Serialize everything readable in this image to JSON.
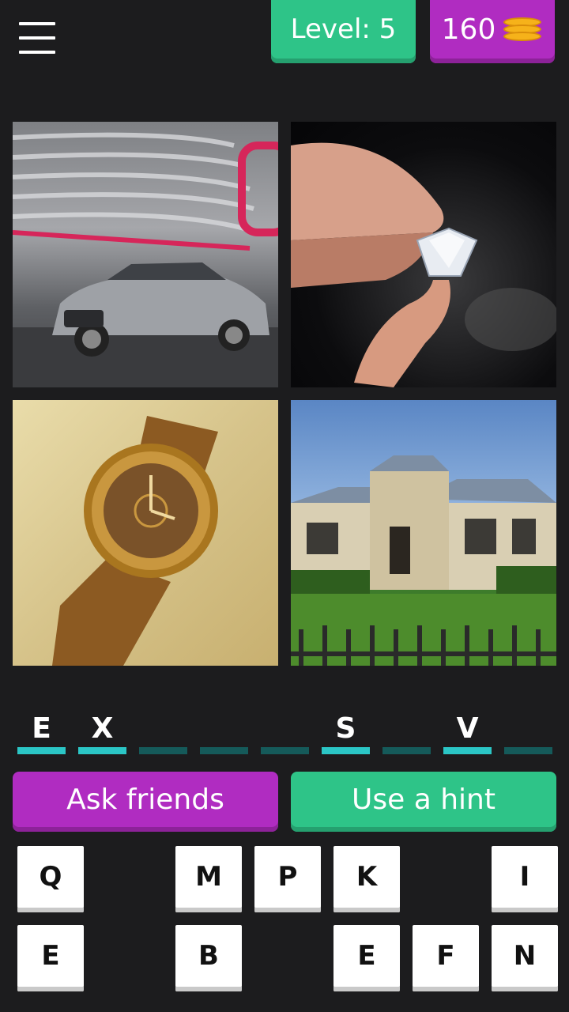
{
  "header": {
    "level_text": "Level: 5",
    "coins": "160"
  },
  "photos": [
    {
      "name": "photo-luxury-car",
      "subject": "silver sports sedan"
    },
    {
      "name": "photo-diamond",
      "subject": "diamond held between fingers"
    },
    {
      "name": "photo-gold-watch",
      "subject": "gold wristwatch"
    },
    {
      "name": "photo-mansion",
      "subject": "stone house with garden"
    }
  ],
  "answer": {
    "slots": [
      "E",
      "X",
      "",
      "",
      "",
      "S",
      "",
      "V",
      ""
    ]
  },
  "actions": {
    "ask_label": "Ask friends",
    "hint_label": "Use a hint"
  },
  "keyboard": {
    "row1": [
      "Q",
      "",
      "M",
      "P",
      "K",
      "",
      "I"
    ],
    "row2": [
      "E",
      "",
      "B",
      "",
      "E",
      "F",
      "N"
    ]
  },
  "colors": {
    "background": "#1c1c1e",
    "green": "#2ec488",
    "purple": "#b02cc1",
    "teal_active": "#2bc6c6",
    "teal_inactive": "#155a5a"
  },
  "icons": {
    "menu": "hamburger-menu-icon",
    "coins": "coin-stack-icon"
  }
}
